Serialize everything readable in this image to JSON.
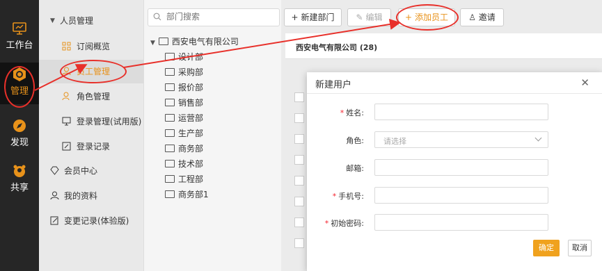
{
  "rail": {
    "items": [
      {
        "label": "工作台",
        "icon": "monitor-icon"
      },
      {
        "label": "管理",
        "icon": "hexagon-gear-icon"
      },
      {
        "label": "发现",
        "icon": "compass-icon"
      },
      {
        "label": "共享",
        "icon": "share-people-icon"
      }
    ]
  },
  "subnav": {
    "group": "人员管理",
    "items": [
      {
        "label": "订阅概览",
        "icon": "grid-icon"
      },
      {
        "label": "员工管理",
        "icon": "user-icon"
      },
      {
        "label": "角色管理",
        "icon": "role-icon"
      },
      {
        "label": "登录管理(试用版)",
        "icon": "monitor-small-icon"
      },
      {
        "label": "登录记录",
        "icon": "edit-icon"
      }
    ],
    "sections": [
      {
        "label": "会员中心",
        "icon": "diamond-icon"
      },
      {
        "label": "我的资料",
        "icon": "person-icon"
      },
      {
        "label": "变更记录(体验版)",
        "icon": "edit-doc-icon"
      }
    ]
  },
  "tree": {
    "search_placeholder": "部门搜索",
    "root": "西安电气有限公司",
    "children": [
      "设计部",
      "采购部",
      "报价部",
      "销售部",
      "运营部",
      "生产部",
      "商务部",
      "技术部",
      "工程部",
      "商务部1"
    ]
  },
  "toolbar": {
    "new_dept": "新建部门",
    "edit": "编辑",
    "add_employee": "添加员工",
    "invite": "邀请"
  },
  "main": {
    "company_header": "西安电气有限公司 (28)"
  },
  "modal": {
    "title": "新建用户",
    "fields": [
      {
        "label": "姓名:",
        "required": true,
        "value": ""
      },
      {
        "label": "角色:",
        "required": false,
        "placeholder": "请选择"
      },
      {
        "label": "邮箱:",
        "required": false,
        "value": ""
      },
      {
        "label": "手机号:",
        "required": true,
        "value": ""
      },
      {
        "label": "初始密码:",
        "required": true,
        "value": ""
      }
    ],
    "ok": "确定",
    "cancel": "取消"
  },
  "colors": {
    "accent": "#f0a21e",
    "annotation": "#e8302a",
    "rail": "#262626"
  }
}
